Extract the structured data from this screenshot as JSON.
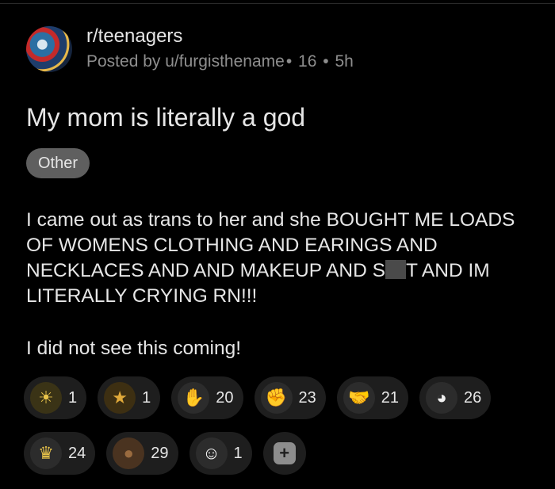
{
  "post": {
    "subreddit": "r/teenagers",
    "posted_by": "Posted by u/furgisthename",
    "flair_count": "16",
    "age": "5h",
    "title": "My mom is literally a god",
    "flair": "Other",
    "body_part1": "I came out as trans to her and she BOUGHT ME LOADS OF WOMENS CLOTHING AND EARINGS AND NECKLACES AND AND MAKEUP AND S",
    "body_part2": "T AND IM LITERALLY CRYING RN!!!",
    "body_para2": "I did not see this coming!"
  },
  "awards": [
    {
      "icon": "sun-award-icon",
      "count": "1",
      "color": "#e8c34a"
    },
    {
      "icon": "star-award-icon",
      "count": "1",
      "color": "#e0a93a"
    },
    {
      "icon": "hand-award-icon",
      "count": "20",
      "color": "#f2f2f2"
    },
    {
      "icon": "rocket-hand-award-icon",
      "count": "23",
      "color": "#d8d8d8"
    },
    {
      "icon": "handshake-award-icon",
      "count": "21",
      "color": "#cfcfcf"
    },
    {
      "icon": "wholesome-face-award-icon",
      "count": "26",
      "color": "#f0f0f0"
    },
    {
      "icon": "crowned-snoo-award-icon",
      "count": "24",
      "color": "#f5f5f5"
    },
    {
      "icon": "bear-award-icon",
      "count": "29",
      "color": "#9a6b3f"
    },
    {
      "icon": "snoo-award-icon",
      "count": "1",
      "color": "#ffffff"
    }
  ],
  "glyphs": {
    "sun": "☀",
    "star": "★",
    "hand": "✋",
    "rocket": "✊",
    "handshake": "🤝",
    "face": "◕",
    "crown": "♛",
    "bear": "●",
    "snoo": "☺",
    "plus": "+",
    "dot": "•"
  }
}
